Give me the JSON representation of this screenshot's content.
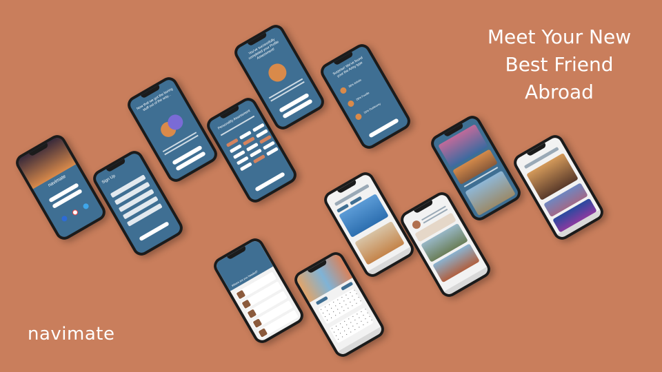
{
  "headline": {
    "line1": "Meet Your New",
    "line2": "Best Friend",
    "line3": "Abroad"
  },
  "brand": "navimate",
  "colors": {
    "background": "#c97e5c",
    "app_blue": "#3f6f93",
    "phone_frame": "#1b1b1b",
    "text": "#ffffff"
  },
  "screens": {
    "launch": {
      "app_name": "navimate"
    },
    "signup": {
      "title": "Sign Up"
    },
    "assessment_intro": {
      "title": "Now that we got the boring stuff out of the way..."
    },
    "personality": {
      "title": "Personality Assessment"
    },
    "complete": {
      "title": "You've successfully completed your Profile Assessment!"
    },
    "result": {
      "title": "Surprise! We've found your the Artsy type",
      "pct1": "38% Artistic",
      "pct2": "28% Foodie",
      "pct3": "16% Outdoorsy"
    },
    "destination": {
      "title": "Where are you headed?"
    },
    "explore": {},
    "planner": {},
    "profile": {},
    "gallery": {},
    "feed": {}
  }
}
